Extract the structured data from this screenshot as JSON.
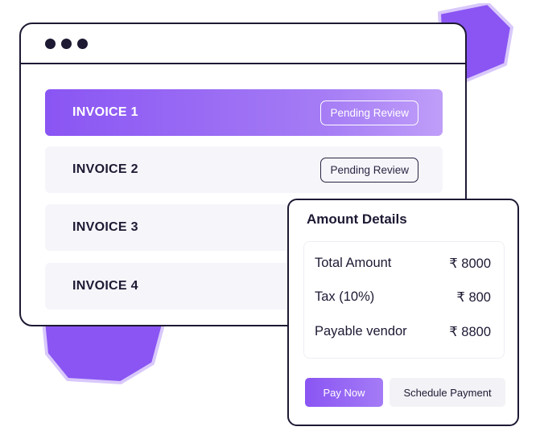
{
  "colors": {
    "accent": "#8a55f3",
    "accent_light": "#bf9ef9",
    "outline": "#1d1933",
    "row_bg": "#f6f5fa"
  },
  "window": {
    "controls": [
      "dot",
      "dot",
      "dot"
    ]
  },
  "invoices": [
    {
      "label": "INVOICE 1",
      "status": "Pending Review",
      "selected": true
    },
    {
      "label": "INVOICE 2",
      "status": "Pending Review",
      "selected": false
    },
    {
      "label": "INVOICE 3",
      "selected": false
    },
    {
      "label": "INVOICE 4",
      "selected": false
    }
  ],
  "amount_details": {
    "title": "Amount Details",
    "rows": [
      {
        "label": "Total Amount",
        "value": "₹ 8000"
      },
      {
        "label": "Tax (10%)",
        "value": "₹ 800"
      },
      {
        "label": "Payable vendor",
        "value": "₹ 8800"
      }
    ],
    "pay_now_label": "Pay Now",
    "schedule_label": "Schedule Payment"
  }
}
